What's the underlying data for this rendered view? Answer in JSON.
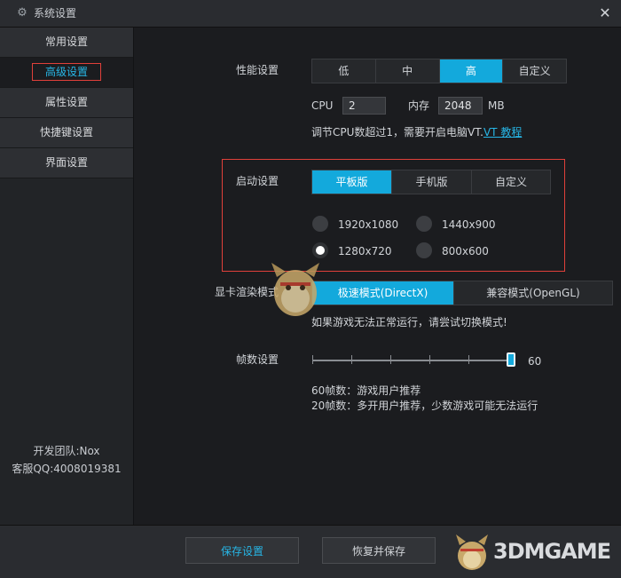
{
  "window": {
    "title": "系统设置",
    "close_symbol": "✕"
  },
  "sidebar": {
    "items": [
      {
        "label": "常用设置",
        "active": false
      },
      {
        "label": "高级设置",
        "active": true
      },
      {
        "label": "属性设置",
        "active": false
      },
      {
        "label": "快捷键设置",
        "active": false
      },
      {
        "label": "界面设置",
        "active": false
      }
    ],
    "team": "开发团队:Nox",
    "support": "客服QQ:4008019381"
  },
  "performance": {
    "label": "性能设置",
    "options": [
      "低",
      "中",
      "高",
      "自定义"
    ],
    "selected": "高",
    "cpu_label": "CPU",
    "cpu_value": "2",
    "mem_label": "内存",
    "mem_value": "2048",
    "mem_unit": "MB",
    "hint_prefix": "调节CPU数超过1，需要开启电脑VT.",
    "hint_link": "VT 教程"
  },
  "startup": {
    "label": "启动设置",
    "options": [
      "平板版",
      "手机版",
      "自定义"
    ],
    "selected": "平板版",
    "resolutions": [
      {
        "label": "1920x1080",
        "checked": false
      },
      {
        "label": "1440x900",
        "checked": false
      },
      {
        "label": "1280x720",
        "checked": true
      },
      {
        "label": "800x600",
        "checked": false
      }
    ]
  },
  "render": {
    "label": "显卡渲染模式",
    "options": [
      "极速模式(DirectX)",
      "兼容模式(OpenGL)"
    ],
    "selected": "极速模式(DirectX)",
    "hint": "如果游戏无法正常运行，请尝试切换模式!"
  },
  "fps": {
    "label": "帧数设置",
    "value": "60",
    "min": 10,
    "max": 60,
    "note1": "60帧数：游戏用户推荐",
    "note2": "20帧数：多开用户推荐，少数游戏可能无法运行"
  },
  "footer": {
    "save_label": "保存设置",
    "restore_label": "恢复并保存"
  },
  "watermark": {
    "text": "3DMGAME"
  },
  "colors": {
    "accent": "#13a9dc",
    "highlight_border": "#e0403a"
  }
}
